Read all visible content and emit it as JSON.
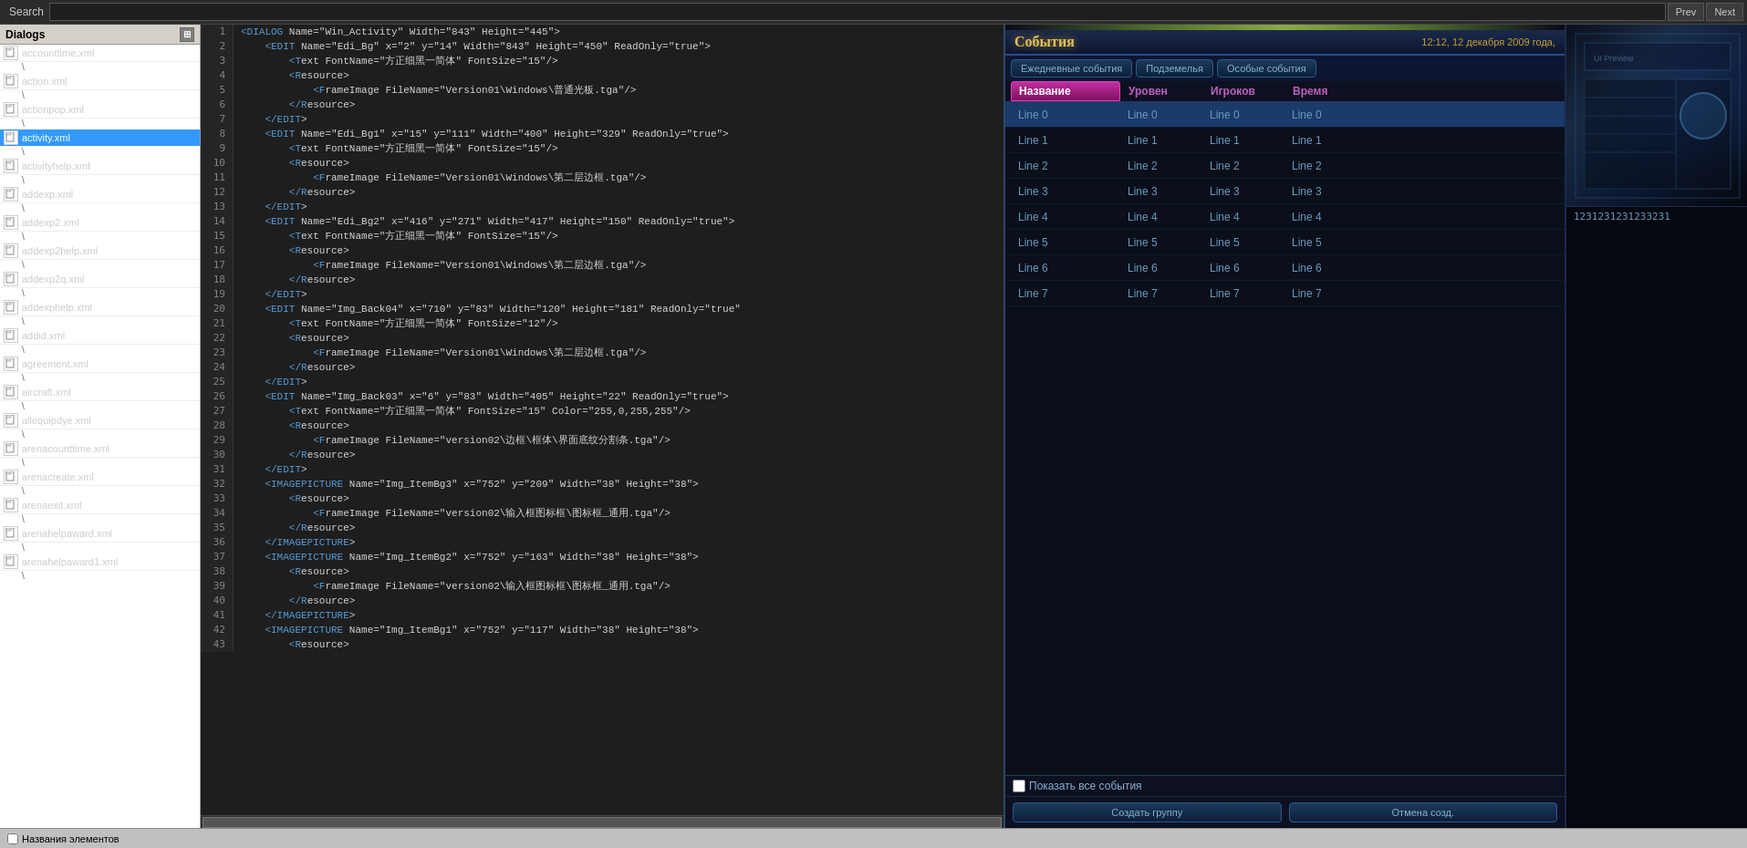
{
  "topbar": {
    "search_label": "Search",
    "prev_label": "Prev",
    "next_label": "Next"
  },
  "left_panel": {
    "title": "Dialogs",
    "files": [
      {
        "name": "accounttime.xml",
        "sub": "\\",
        "selected": false
      },
      {
        "name": "action.xml",
        "sub": "\\",
        "selected": false
      },
      {
        "name": "actionpop.xml",
        "sub": "\\",
        "selected": false
      },
      {
        "name": "activity.xml",
        "sub": "\\",
        "selected": true
      },
      {
        "name": "activityhelp.xml",
        "sub": "\\",
        "selected": false
      },
      {
        "name": "addexp.xml",
        "sub": "\\",
        "selected": false
      },
      {
        "name": "addexp2.xml",
        "sub": "\\",
        "selected": false
      },
      {
        "name": "addexp2help.xml",
        "sub": "\\",
        "selected": false
      },
      {
        "name": "addexp2q.xml",
        "sub": "\\",
        "selected": false
      },
      {
        "name": "addexphelp.xml",
        "sub": "\\",
        "selected": false
      },
      {
        "name": "addid.xml",
        "sub": "\\",
        "selected": false
      },
      {
        "name": "agreement.xml",
        "sub": "\\",
        "selected": false
      },
      {
        "name": "aircraft.xml",
        "sub": "\\",
        "selected": false
      },
      {
        "name": "allequipdye.xml",
        "sub": "\\",
        "selected": false
      },
      {
        "name": "arenacounttime.xml",
        "sub": "\\",
        "selected": false
      },
      {
        "name": "arenacreate.xml",
        "sub": "\\",
        "selected": false
      },
      {
        "name": "arenaexit.xml",
        "sub": "\\",
        "selected": false
      },
      {
        "name": "arenahelpaward.xml",
        "sub": "\\",
        "selected": false
      },
      {
        "name": "arenahelpaward1.xml",
        "sub": "\\",
        "selected": false
      }
    ]
  },
  "code_lines": [
    {
      "num": 1,
      "content": "<DIALOG Name=\"Win_Activity\" Width=\"843\" Height=\"445\">"
    },
    {
      "num": 2,
      "content": "    <EDIT Name=\"Edi_Bg\" x=\"2\" y=\"14\" Width=\"843\" Height=\"450\" ReadOnly=\"true\">"
    },
    {
      "num": 3,
      "content": "        <Text FontName=\"方正细黑一简体\" FontSize=\"15\"/>"
    },
    {
      "num": 4,
      "content": "        <Resource>"
    },
    {
      "num": 5,
      "content": "            <FrameImage FileName=\"Version01\\Windows\\普通光板.tga\"/>"
    },
    {
      "num": 6,
      "content": "        </Resource>"
    },
    {
      "num": 7,
      "content": "    </EDIT>"
    },
    {
      "num": 8,
      "content": "    <EDIT Name=\"Edi_Bg1\" x=\"15\" y=\"111\" Width=\"400\" Height=\"329\" ReadOnly=\"true\">"
    },
    {
      "num": 9,
      "content": "        <Text FontName=\"方正细黑一简体\" FontSize=\"15\"/>"
    },
    {
      "num": 10,
      "content": "        <Resource>"
    },
    {
      "num": 11,
      "content": "            <FrameImage FileName=\"Version01\\Windows\\第二层边框.tga\"/>"
    },
    {
      "num": 12,
      "content": "        </Resource>"
    },
    {
      "num": 13,
      "content": "    </EDIT>"
    },
    {
      "num": 14,
      "content": "    <EDIT Name=\"Edi_Bg2\" x=\"416\" y=\"271\" Width=\"417\" Height=\"150\" ReadOnly=\"true\">"
    },
    {
      "num": 15,
      "content": "        <Text FontName=\"方正细黑一简体\" FontSize=\"15\"/>"
    },
    {
      "num": 16,
      "content": "        <Resource>"
    },
    {
      "num": 17,
      "content": "            <FrameImage FileName=\"Version01\\Windows\\第二层边框.tga\"/>"
    },
    {
      "num": 18,
      "content": "        </Resource>"
    },
    {
      "num": 19,
      "content": "    </EDIT>"
    },
    {
      "num": 20,
      "content": "    <EDIT Name=\"Img_Back04\" x=\"710\" y=\"83\" Width=\"120\" Height=\"181\" ReadOnly=\"true\""
    },
    {
      "num": 21,
      "content": "        <Text FontName=\"方正细黑一简体\" FontSize=\"12\"/>"
    },
    {
      "num": 22,
      "content": "        <Resource>"
    },
    {
      "num": 23,
      "content": "            <FrameImage FileName=\"Version01\\Windows\\第二层边框.tga\"/>"
    },
    {
      "num": 24,
      "content": "        </Resource>"
    },
    {
      "num": 25,
      "content": "    </EDIT>"
    },
    {
      "num": 26,
      "content": "    <EDIT Name=\"Img_Back03\" x=\"6\" y=\"83\" Width=\"405\" Height=\"22\" ReadOnly=\"true\">"
    },
    {
      "num": 27,
      "content": "        <Text FontName=\"方正细黑一简体\" FontSize=\"15\" Color=\"255,0,255,255\"/>"
    },
    {
      "num": 28,
      "content": "        <Resource>"
    },
    {
      "num": 29,
      "content": "            <FrameImage FileName=\"version02\\边框\\框体\\界面底纹分割条.tga\"/>"
    },
    {
      "num": 30,
      "content": "        </Resource>"
    },
    {
      "num": 31,
      "content": "    </EDIT>"
    },
    {
      "num": 32,
      "content": "    <IMAGEPICTURE Name=\"Img_ItemBg3\" x=\"752\" y=\"209\" Width=\"38\" Height=\"38\">"
    },
    {
      "num": 33,
      "content": "        <Resource>"
    },
    {
      "num": 34,
      "content": "            <FrameImage FileName=\"version02\\输入框图标框\\图标框_通用.tga\"/>"
    },
    {
      "num": 35,
      "content": "        </Resource>"
    },
    {
      "num": 36,
      "content": "    </IMAGEPICTURE>"
    },
    {
      "num": 37,
      "content": "    <IMAGEPICTURE Name=\"Img_ItemBg2\" x=\"752\" y=\"163\" Width=\"38\" Height=\"38\">"
    },
    {
      "num": 38,
      "content": "        <Resource>"
    },
    {
      "num": 39,
      "content": "            <FrameImage FileName=\"version02\\输入框图标框\\图标框_通用.tga\"/>"
    },
    {
      "num": 40,
      "content": "        </Resource>"
    },
    {
      "num": 41,
      "content": "    </IMAGEPICTURE>"
    },
    {
      "num": 42,
      "content": "    <IMAGEPICTURE Name=\"Img_ItemBg1\" x=\"752\" y=\"117\" Width=\"38\" Height=\"38\">"
    },
    {
      "num": 43,
      "content": "        <Resource>"
    }
  ],
  "right_panel": {
    "title": "События",
    "datetime": "12:12, 12 декабря 2009 года,",
    "tabs": [
      {
        "label": "Ежедневные события",
        "active": false
      },
      {
        "label": "Подземелья",
        "active": false
      },
      {
        "label": "Особые события",
        "active": false
      }
    ],
    "columns": [
      {
        "label": "Название",
        "active": true,
        "key": "name"
      },
      {
        "label": "Уровен",
        "active": false,
        "key": "level"
      },
      {
        "label": "Игроков",
        "active": false,
        "key": "players"
      },
      {
        "label": "Время",
        "active": false,
        "key": "time"
      }
    ],
    "rows": [
      {
        "name": "Line 0",
        "level": "Line 0",
        "players": "Line 0",
        "time": "Line 0",
        "selected": true
      },
      {
        "name": "Line 1",
        "level": "Line 1",
        "players": "Line 1",
        "time": "Line 1",
        "selected": false
      },
      {
        "name": "Line 2",
        "level": "Line 2",
        "players": "Line 2",
        "time": "Line 2",
        "selected": false
      },
      {
        "name": "Line 3",
        "level": "Line 3",
        "players": "Line 3",
        "time": "Line 3",
        "selected": false
      },
      {
        "name": "Line 4",
        "level": "Line 4",
        "players": "Line 4",
        "time": "Line 4",
        "selected": false
      },
      {
        "name": "Line 5",
        "level": "Line 5",
        "players": "Line 5",
        "time": "Line 5",
        "selected": false
      },
      {
        "name": "Line 6",
        "level": "Line 6",
        "players": "Line 6",
        "time": "Line 6",
        "selected": false
      },
      {
        "name": "Line 7",
        "level": "Line 7",
        "players": "Line 7",
        "time": "Line 7",
        "selected": false
      }
    ],
    "show_all_label": "Показать все события",
    "create_group_btn": "Создать группу",
    "cancel_btn": "Отмена созд."
  },
  "preview": {
    "number": "1231231231233231"
  },
  "bottom_bar": {
    "checkbox_label": "Названия элементов"
  }
}
